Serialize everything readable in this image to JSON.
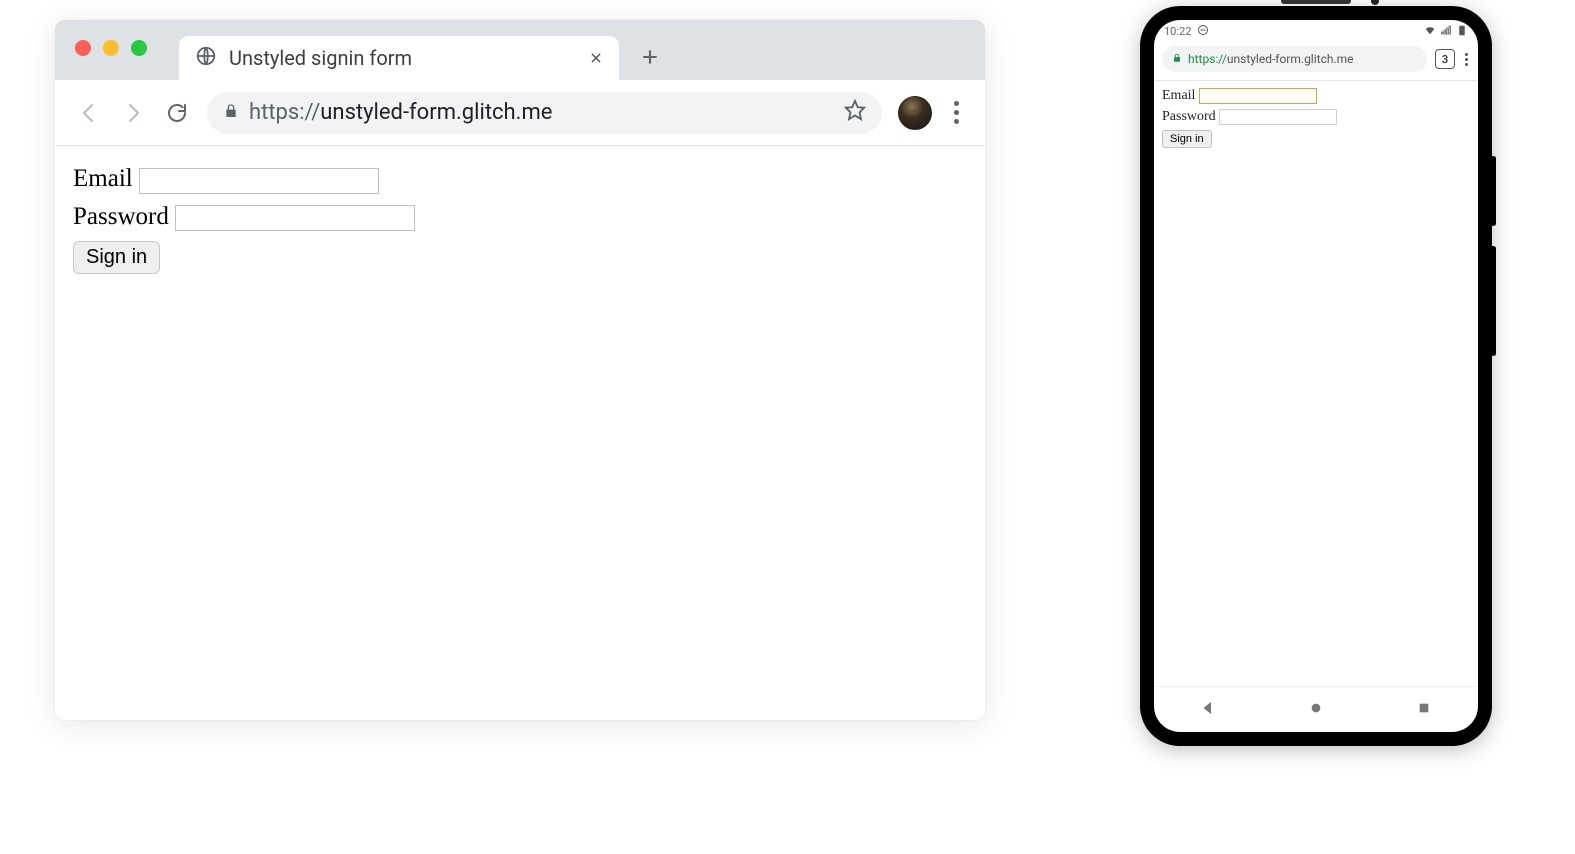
{
  "desktop": {
    "tab_title": "Unstyled signin form",
    "url_scheme": "https://",
    "url_host": "unstyled-form.glitch.me",
    "form": {
      "email_label": "Email",
      "password_label": "Password",
      "submit_label": "Sign in"
    }
  },
  "mobile": {
    "status_time": "10:22",
    "url_scheme": "https://",
    "url_host": "unstyled-form.glitch.me",
    "tab_count": "3",
    "form": {
      "email_label": "Email",
      "password_label": "Password",
      "submit_label": "Sign in"
    }
  }
}
